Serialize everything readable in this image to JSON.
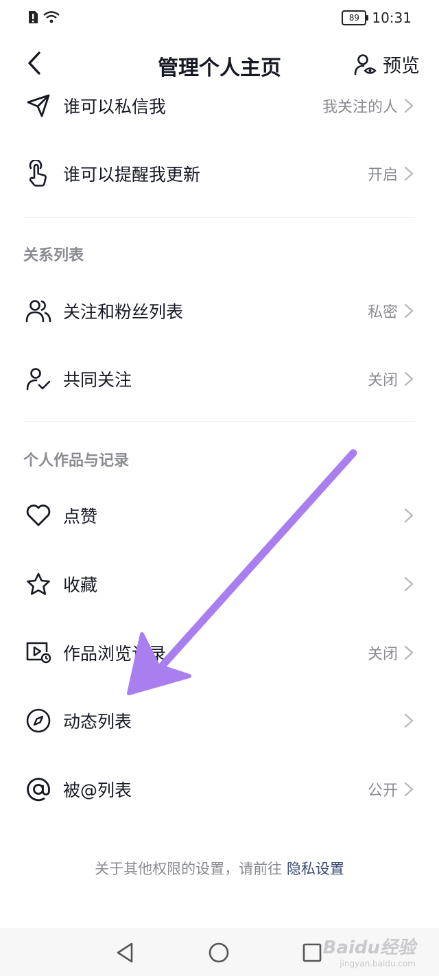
{
  "status_bar": {
    "battery": "89",
    "time": "10:31"
  },
  "header": {
    "title": "管理个人主页",
    "preview_label": "预览"
  },
  "privacy_rows": [
    {
      "label": "谁可以私信我",
      "value": "我关注的人",
      "icon": "send-icon"
    },
    {
      "label": "谁可以提醒我更新",
      "value": "开启",
      "icon": "tap-hand-icon"
    }
  ],
  "relations": {
    "title": "关系列表",
    "rows": [
      {
        "label": "关注和粉丝列表",
        "value": "私密",
        "icon": "users-icon"
      },
      {
        "label": "共同关注",
        "value": "关闭",
        "icon": "user-check-icon"
      }
    ]
  },
  "works": {
    "title": "个人作品与记录",
    "rows": [
      {
        "label": "点赞",
        "value": "",
        "icon": "heart-icon"
      },
      {
        "label": "收藏",
        "value": "",
        "icon": "star-icon"
      },
      {
        "label": "作品浏览记录",
        "value": "关闭",
        "icon": "video-history-icon"
      },
      {
        "label": "动态列表",
        "value": "",
        "icon": "compass-icon"
      },
      {
        "label": "被@列表",
        "value": "公开",
        "icon": "at-icon"
      }
    ]
  },
  "footer": {
    "note": "关于其他权限的设置，请前往",
    "link": "隐私设置"
  },
  "annotation": {
    "arrow_color": "#a97ff0"
  },
  "watermark": {
    "brand": "Baidu经验",
    "url": "jingyan.baidu.com"
  }
}
